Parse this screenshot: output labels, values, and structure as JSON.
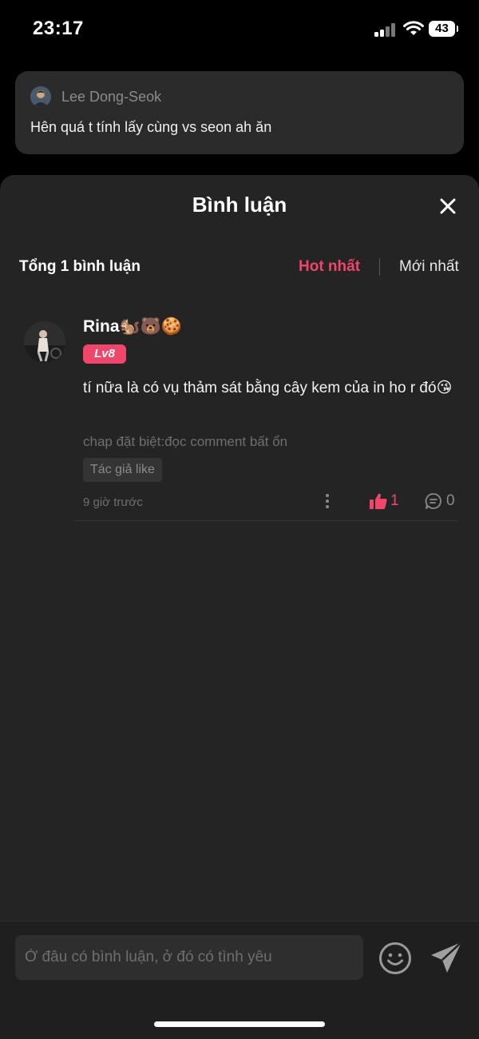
{
  "status_bar": {
    "time": "23:17",
    "battery": "43"
  },
  "previous_comment": {
    "author": "Lee Dong-Seok",
    "text": "Hên quá t tính lấy cùng vs seon ah ăn"
  },
  "comments_sheet": {
    "title": "Bình luận",
    "total_label": "Tổng 1 bình luận",
    "sort_options": [
      "Hot nhất",
      "Mới nhất"
    ],
    "active_sort": "Hot nhất",
    "comments": [
      {
        "author": "Rina🐿️🐻🍪",
        "level": "Lv8",
        "text": "tí nữa là có vụ thảm sát bằng cây kem của in ho r đó😘",
        "chapter_note": "chap đặt biệt:đọc comment bất ổn",
        "badge": "Tác giả like",
        "time": "9 giờ trước",
        "likes": "1",
        "replies": "0"
      }
    ]
  },
  "input_bar": {
    "placeholder": "Ở đâu có bình luận, ở đó có tình yêu"
  },
  "colors": {
    "accent": "#f0466b",
    "sheet_background": "#242424",
    "card_background": "#2b2b2b"
  },
  "icons": [
    "signal-icon",
    "wifi-icon",
    "battery-icon",
    "close-icon",
    "more-icon",
    "thumbs-up-icon",
    "comment-icon",
    "smiley-icon",
    "send-icon"
  ]
}
